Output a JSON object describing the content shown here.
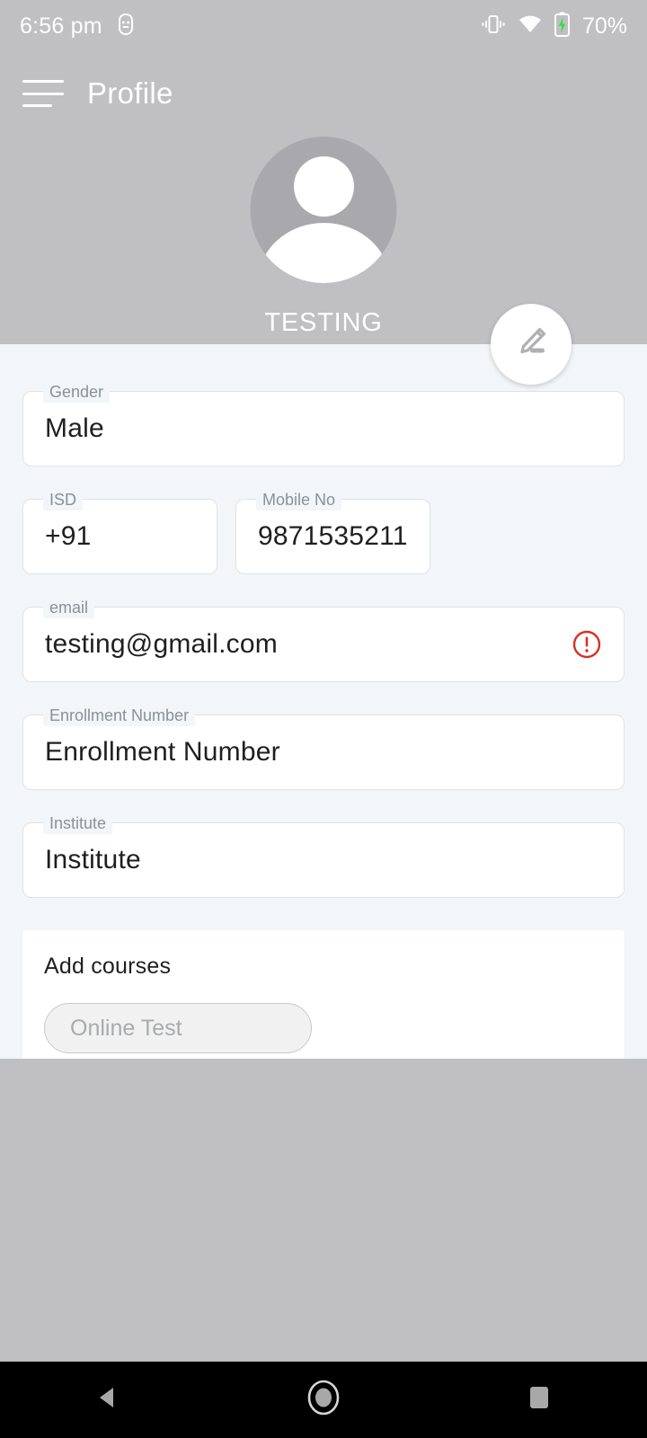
{
  "status_bar": {
    "time": "6:56 pm",
    "usb_icon": "usb-debug-icon",
    "vibrate_icon": "vibrate-icon",
    "wifi_icon": "wifi-icon",
    "battery_icon": "battery-charging-icon",
    "battery_percent": "70%"
  },
  "app_bar": {
    "menu_icon": "hamburger-menu-icon",
    "title": "Profile"
  },
  "profile": {
    "avatar_icon": "person-avatar-icon",
    "name": "TESTING",
    "edit_fab_icon": "edit-pencil-icon"
  },
  "form": {
    "gender": {
      "label": "Gender",
      "value": "Male"
    },
    "isd": {
      "label": "ISD",
      "value": "+91"
    },
    "mobile": {
      "label": "Mobile No",
      "value": "9871535211"
    },
    "email": {
      "label": "email",
      "value": "testing@gmail.com",
      "error_icon": "error-exclamation-icon"
    },
    "enrollment": {
      "label": "Enrollment Number",
      "value": "Enrollment Number"
    },
    "institute": {
      "label": "Institute",
      "value": "Institute"
    }
  },
  "courses": {
    "title": "Add courses",
    "chips": [
      {
        "label": "Online Test"
      }
    ]
  },
  "nav_bar": {
    "back": "back-triangle-icon",
    "home": "home-circle-icon",
    "recents": "recents-square-icon"
  },
  "colors": {
    "header_grey": "#c0c0c3",
    "page_bg": "#f2f6f8",
    "field_border": "#dfe3e5",
    "label_grey": "#8a9199",
    "error_red": "#d93025",
    "battery_green": "#3ddc44",
    "nav_bg": "#000000"
  }
}
